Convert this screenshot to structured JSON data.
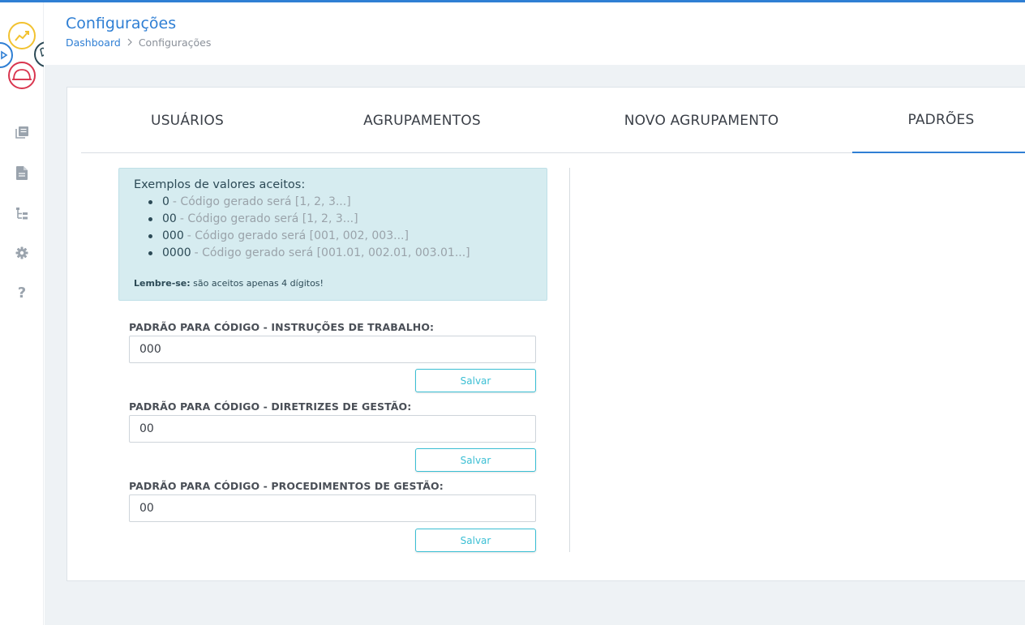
{
  "header": {
    "title": "Configurações",
    "breadcrumb": {
      "home": "Dashboard",
      "separator": ">",
      "current": "Configurações"
    }
  },
  "sidebar": {
    "icons": [
      "library-icon",
      "document-icon",
      "hierarchy-icon",
      "gear-icon",
      "help-icon"
    ],
    "help_glyph": "?"
  },
  "tabs": [
    {
      "label": "USUÁRIOS",
      "active": false
    },
    {
      "label": "AGRUPAMENTOS",
      "active": false
    },
    {
      "label": "NOVO AGRUPAMENTO",
      "active": false
    },
    {
      "label": "PADRÕES",
      "active": true
    }
  ],
  "info": {
    "title": "Exemplos de valores aceitos:",
    "examples": [
      {
        "value": "0",
        "text": "- Código gerado será [1, 2, 3...]"
      },
      {
        "value": "00",
        "text": "- Código gerado será [1, 2, 3...]"
      },
      {
        "value": "000",
        "text": "- Código gerado será [001, 002, 003...]"
      },
      {
        "value": "0000",
        "text": "- Código gerado será [001.01, 002.01, 003.01...]"
      }
    ],
    "note_bold": "Lembre-se:",
    "note_text": "são aceitos apenas 4 dígitos!"
  },
  "fields": [
    {
      "label": "PADRÃO PARA CÓDIGO - INSTRUÇÕES DE TRABALHO:",
      "value": "000",
      "button": "Salvar"
    },
    {
      "label": "PADRÃO PARA CÓDIGO - DIRETRIZES DE GESTÃO:",
      "value": "00",
      "button": "Salvar"
    },
    {
      "label": "PADRÃO PARA CÓDIGO - PROCEDIMENTOS DE GESTÃO:",
      "value": "00",
      "button": "Salvar"
    }
  ],
  "colors": {
    "accent": "#2f7fd4",
    "info_bg": "#d6ecf0",
    "button": "#3bbfd4"
  }
}
